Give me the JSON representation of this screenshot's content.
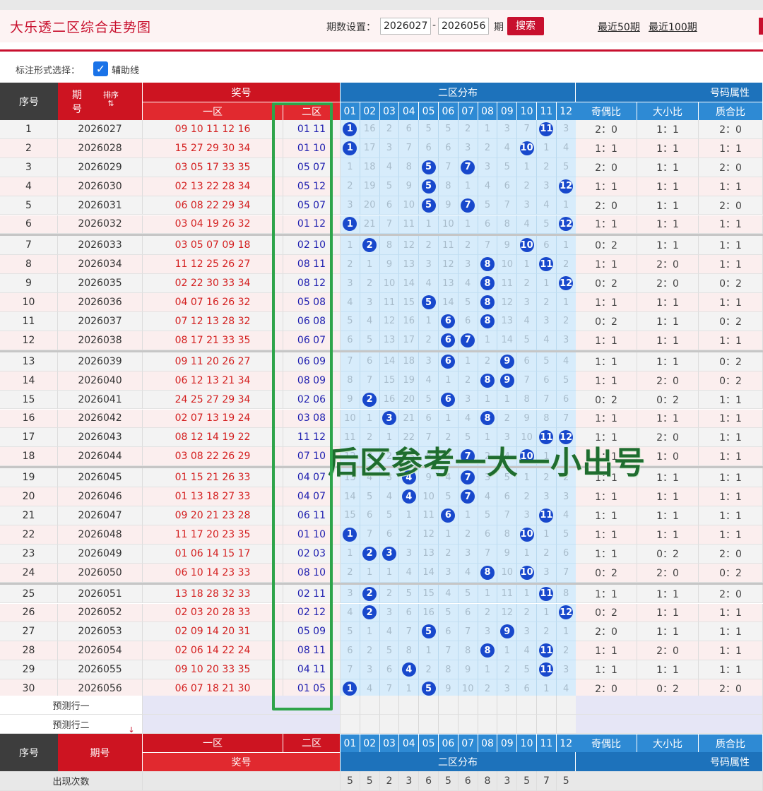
{
  "header": {
    "title": "大乐透二区综合走势图",
    "range_label": "期数设置：",
    "range_start": "2026027",
    "range_end": "2026056",
    "dash": "-",
    "unit": "期",
    "search": "搜索",
    "quick_50": "最近50期",
    "quick_100": "最近100期"
  },
  "options": {
    "label": "标注形式选择：",
    "aux_line": "辅助线",
    "aux_checked": true
  },
  "table_header": {
    "idx": "序号",
    "period_a": "期",
    "period_b": "号",
    "sort": "排序",
    "prize": "奖号",
    "zone1": "一区",
    "zone2": "二区",
    "dist": "二区分布",
    "attr": "号码属性",
    "odd_even": "奇偶比",
    "big_small": "大小比",
    "prime_comp": "质合比",
    "numbers": [
      "01",
      "02",
      "03",
      "04",
      "05",
      "06",
      "07",
      "08",
      "09",
      "10",
      "11",
      "12"
    ]
  },
  "rows": [
    {
      "i": "1",
      "p": "2026027",
      "z1": "09 10 11 12 16",
      "z2": "01 11",
      "oe": "2：0",
      "bs": "1：1",
      "pc": "2：0",
      "d": [
        "1",
        "16",
        "2",
        "6",
        "5",
        "5",
        "2",
        "1",
        "3",
        "7",
        "11",
        "3"
      ],
      "h": [
        1,
        11
      ]
    },
    {
      "i": "2",
      "p": "2026028",
      "z1": "15 27 29 30 34",
      "z2": "01 10",
      "oe": "1：1",
      "bs": "1：1",
      "pc": "1：1",
      "d": [
        "1",
        "17",
        "3",
        "7",
        "6",
        "6",
        "3",
        "2",
        "4",
        "10",
        "1",
        "4"
      ],
      "h": [
        1,
        10
      ]
    },
    {
      "i": "3",
      "p": "2026029",
      "z1": "03 05 17 33 35",
      "z2": "05 07",
      "oe": "2：0",
      "bs": "1：1",
      "pc": "2：0",
      "d": [
        "1",
        "18",
        "4",
        "8",
        "5",
        "7",
        "7",
        "3",
        "5",
        "1",
        "2",
        "5"
      ],
      "h": [
        5,
        7
      ]
    },
    {
      "i": "4",
      "p": "2026030",
      "z1": "02 13 22 28 34",
      "z2": "05 12",
      "oe": "1：1",
      "bs": "1：1",
      "pc": "1：1",
      "d": [
        "2",
        "19",
        "5",
        "9",
        "5",
        "8",
        "1",
        "4",
        "6",
        "2",
        "3",
        "12"
      ],
      "h": [
        5,
        12
      ]
    },
    {
      "i": "5",
      "p": "2026031",
      "z1": "06 08 22 29 34",
      "z2": "05 07",
      "oe": "2：0",
      "bs": "1：1",
      "pc": "2：0",
      "d": [
        "3",
        "20",
        "6",
        "10",
        "5",
        "9",
        "7",
        "5",
        "7",
        "3",
        "4",
        "1"
      ],
      "h": [
        5,
        7
      ]
    },
    {
      "i": "6",
      "p": "2026032",
      "z1": "03 04 19 26 32",
      "z2": "01 12",
      "oe": "1：1",
      "bs": "1：1",
      "pc": "1：1",
      "d": [
        "1",
        "21",
        "7",
        "11",
        "1",
        "10",
        "1",
        "6",
        "8",
        "4",
        "5",
        "12"
      ],
      "h": [
        1,
        12
      ]
    },
    {
      "i": "7",
      "p": "2026033",
      "z1": "03 05 07 09 18",
      "z2": "02 10",
      "oe": "0：2",
      "bs": "1：1",
      "pc": "1：1",
      "d": [
        "1",
        "2",
        "8",
        "12",
        "2",
        "11",
        "2",
        "7",
        "9",
        "10",
        "6",
        "1"
      ],
      "h": [
        2,
        10
      ]
    },
    {
      "i": "8",
      "p": "2026034",
      "z1": "11 12 25 26 27",
      "z2": "08 11",
      "oe": "1：1",
      "bs": "2：0",
      "pc": "1：1",
      "d": [
        "2",
        "1",
        "9",
        "13",
        "3",
        "12",
        "3",
        "8",
        "10",
        "1",
        "11",
        "2"
      ],
      "h": [
        8,
        11
      ]
    },
    {
      "i": "9",
      "p": "2026035",
      "z1": "02 22 30 33 34",
      "z2": "08 12",
      "oe": "0：2",
      "bs": "2：0",
      "pc": "0：2",
      "d": [
        "3",
        "2",
        "10",
        "14",
        "4",
        "13",
        "4",
        "8",
        "11",
        "2",
        "1",
        "12"
      ],
      "h": [
        8,
        12
      ]
    },
    {
      "i": "10",
      "p": "2026036",
      "z1": "04 07 16 26 32",
      "z2": "05 08",
      "oe": "1：1",
      "bs": "1：1",
      "pc": "1：1",
      "d": [
        "4",
        "3",
        "11",
        "15",
        "5",
        "14",
        "5",
        "8",
        "12",
        "3",
        "2",
        "1"
      ],
      "h": [
        5,
        8
      ]
    },
    {
      "i": "11",
      "p": "2026037",
      "z1": "07 12 13 28 32",
      "z2": "06 08",
      "oe": "0：2",
      "bs": "1：1",
      "pc": "0：2",
      "d": [
        "5",
        "4",
        "12",
        "16",
        "1",
        "6",
        "6",
        "8",
        "13",
        "4",
        "3",
        "2"
      ],
      "h": [
        6,
        8
      ]
    },
    {
      "i": "12",
      "p": "2026038",
      "z1": "08 17 21 33 35",
      "z2": "06 07",
      "oe": "1：1",
      "bs": "1：1",
      "pc": "1：1",
      "d": [
        "6",
        "5",
        "13",
        "17",
        "2",
        "6",
        "7",
        "1",
        "14",
        "5",
        "4",
        "3"
      ],
      "h": [
        6,
        7
      ]
    },
    {
      "i": "13",
      "p": "2026039",
      "z1": "09 11 20 26 27",
      "z2": "06 09",
      "oe": "1：1",
      "bs": "1：1",
      "pc": "0：2",
      "d": [
        "7",
        "6",
        "14",
        "18",
        "3",
        "6",
        "1",
        "2",
        "9",
        "6",
        "5",
        "4"
      ],
      "h": [
        6,
        9
      ]
    },
    {
      "i": "14",
      "p": "2026040",
      "z1": "06 12 13 21 34",
      "z2": "08 09",
      "oe": "1：1",
      "bs": "2：0",
      "pc": "0：2",
      "d": [
        "8",
        "7",
        "15",
        "19",
        "4",
        "1",
        "2",
        "8",
        "9",
        "7",
        "6",
        "5"
      ],
      "h": [
        8,
        9
      ]
    },
    {
      "i": "15",
      "p": "2026041",
      "z1": "24 25 27 29 34",
      "z2": "02 06",
      "oe": "0：2",
      "bs": "0：2",
      "pc": "1：1",
      "d": [
        "9",
        "2",
        "16",
        "20",
        "5",
        "6",
        "3",
        "1",
        "1",
        "8",
        "7",
        "6"
      ],
      "h": [
        2,
        6
      ]
    },
    {
      "i": "16",
      "p": "2026042",
      "z1": "02 07 13 19 24",
      "z2": "03 08",
      "oe": "1：1",
      "bs": "1：1",
      "pc": "1：1",
      "d": [
        "10",
        "1",
        "3",
        "21",
        "6",
        "1",
        "4",
        "8",
        "2",
        "9",
        "8",
        "7"
      ],
      "h": [
        3,
        8
      ]
    },
    {
      "i": "17",
      "p": "2026043",
      "z1": "08 12 14 19 22",
      "z2": "11 12",
      "oe": "1：1",
      "bs": "2：0",
      "pc": "1：1",
      "d": [
        "11",
        "2",
        "1",
        "22",
        "7",
        "2",
        "5",
        "1",
        "3",
        "10",
        "11",
        "12"
      ],
      "h": [
        11,
        12
      ]
    },
    {
      "i": "18",
      "p": "2026044",
      "z1": "03 08 22 26 29",
      "z2": "07 10",
      "oe": "1：1",
      "bs": "1：0",
      "pc": "1：1",
      "d": [
        "12",
        "3",
        "2",
        "23",
        "8",
        "3",
        "7",
        "2",
        "4",
        "10",
        "1",
        "1"
      ],
      "h": [
        7,
        10
      ]
    },
    {
      "i": "19",
      "p": "2026045",
      "z1": "01 15 21 26 33",
      "z2": "04 07",
      "oe": "1：1",
      "bs": "1：1",
      "pc": "1：1",
      "d": [
        "13",
        "4",
        "3",
        "4",
        "9",
        "4",
        "7",
        "3",
        "5",
        "1",
        "2",
        "2"
      ],
      "h": [
        4,
        7
      ]
    },
    {
      "i": "20",
      "p": "2026046",
      "z1": "01 13 18 27 33",
      "z2": "04 07",
      "oe": "1：1",
      "bs": "1：1",
      "pc": "1：1",
      "d": [
        "14",
        "5",
        "4",
        "4",
        "10",
        "5",
        "7",
        "4",
        "6",
        "2",
        "3",
        "3"
      ],
      "h": [
        4,
        7
      ]
    },
    {
      "i": "21",
      "p": "2026047",
      "z1": "09 20 21 23 28",
      "z2": "06 11",
      "oe": "1：1",
      "bs": "1：1",
      "pc": "1：1",
      "d": [
        "15",
        "6",
        "5",
        "1",
        "11",
        "6",
        "1",
        "5",
        "7",
        "3",
        "11",
        "4"
      ],
      "h": [
        6,
        11
      ]
    },
    {
      "i": "22",
      "p": "2026048",
      "z1": "11 17 20 23 35",
      "z2": "01 10",
      "oe": "1：1",
      "bs": "1：1",
      "pc": "1：1",
      "d": [
        "1",
        "7",
        "6",
        "2",
        "12",
        "1",
        "2",
        "6",
        "8",
        "10",
        "1",
        "5"
      ],
      "h": [
        1,
        10
      ]
    },
    {
      "i": "23",
      "p": "2026049",
      "z1": "01 06 14 15 17",
      "z2": "02 03",
      "oe": "1：1",
      "bs": "0：2",
      "pc": "2：0",
      "d": [
        "1",
        "2",
        "3",
        "3",
        "13",
        "2",
        "3",
        "7",
        "9",
        "1",
        "2",
        "6"
      ],
      "h": [
        2,
        3
      ]
    },
    {
      "i": "24",
      "p": "2026050",
      "z1": "06 10 14 23 33",
      "z2": "08 10",
      "oe": "0：2",
      "bs": "2：0",
      "pc": "0：2",
      "d": [
        "2",
        "1",
        "1",
        "4",
        "14",
        "3",
        "4",
        "8",
        "10",
        "10",
        "3",
        "7"
      ],
      "h": [
        8,
        10
      ]
    },
    {
      "i": "25",
      "p": "2026051",
      "z1": "13 18 28 32 33",
      "z2": "02 11",
      "oe": "1：1",
      "bs": "1：1",
      "pc": "2：0",
      "d": [
        "3",
        "2",
        "2",
        "5",
        "15",
        "4",
        "5",
        "1",
        "11",
        "1",
        "11",
        "8"
      ],
      "h": [
        2,
        11
      ]
    },
    {
      "i": "26",
      "p": "2026052",
      "z1": "02 03 20 28 33",
      "z2": "02 12",
      "oe": "0：2",
      "bs": "1：1",
      "pc": "1：1",
      "d": [
        "4",
        "2",
        "3",
        "6",
        "16",
        "5",
        "6",
        "2",
        "12",
        "2",
        "1",
        "12"
      ],
      "h": [
        2,
        12
      ]
    },
    {
      "i": "27",
      "p": "2026053",
      "z1": "02 09 14 20 31",
      "z2": "05 09",
      "oe": "2：0",
      "bs": "1：1",
      "pc": "1：1",
      "d": [
        "5",
        "1",
        "4",
        "7",
        "5",
        "6",
        "7",
        "3",
        "9",
        "3",
        "2",
        "1"
      ],
      "h": [
        5,
        9
      ]
    },
    {
      "i": "28",
      "p": "2026054",
      "z1": "02 06 14 22 24",
      "z2": "08 11",
      "oe": "1：1",
      "bs": "2：0",
      "pc": "1：1",
      "d": [
        "6",
        "2",
        "5",
        "8",
        "1",
        "7",
        "8",
        "8",
        "1",
        "4",
        "11",
        "2"
      ],
      "h": [
        8,
        11
      ]
    },
    {
      "i": "29",
      "p": "2026055",
      "z1": "09 10 20 33 35",
      "z2": "04 11",
      "oe": "1：1",
      "bs": "1：1",
      "pc": "1：1",
      "d": [
        "7",
        "3",
        "6",
        "4",
        "2",
        "8",
        "9",
        "1",
        "2",
        "5",
        "11",
        "3"
      ],
      "h": [
        4,
        11
      ]
    },
    {
      "i": "30",
      "p": "2026056",
      "z1": "06 07 18 21 30",
      "z2": "01 05",
      "oe": "2：0",
      "bs": "0：2",
      "pc": "2：0",
      "d": [
        "1",
        "4",
        "7",
        "1",
        "5",
        "9",
        "10",
        "2",
        "3",
        "6",
        "1",
        "4"
      ],
      "h": [
        1,
        5
      ]
    }
  ],
  "predict": {
    "row1": "预测行一",
    "row2": "预测行二",
    "arrow": "↓"
  },
  "footer": {
    "idx": "序号",
    "period": "期号",
    "zone1": "一区",
    "zone2": "二区",
    "prize": "奖号",
    "dist": "二区分布",
    "attr": "号码属性",
    "odd_even": "奇偶比",
    "big_small": "大小比",
    "prime_comp": "质合比",
    "count_label": "出现次数",
    "counts": [
      "5",
      "5",
      "2",
      "3",
      "6",
      "5",
      "6",
      "8",
      "3",
      "5",
      "7",
      "5"
    ]
  },
  "overlay_text": "后区参考一大一小出号",
  "colors": {
    "brand_red": "#c8102e",
    "header_blue": "#1d72bb",
    "ball_blue": "#1848cc",
    "highlight_green": "#2ea44a"
  }
}
